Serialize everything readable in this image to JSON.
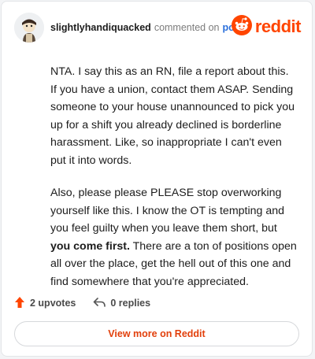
{
  "header": {
    "username": "slightlyhandiquacked",
    "commented_text": "commented on",
    "post_link": "post",
    "brand": "reddit"
  },
  "comment": {
    "p1": "NTA. I say this as an RN, file a report about this. If you have a union, contact them ASAP. Sending someone to your house unannounced to pick you up for a shift you already declined is borderline harassment. Like, so inappropriate I can't even put it into words.",
    "p2_start": "Also, please please PLEASE stop overworking yourself like this. I know the OT is tempting and you feel guilty when you leave them short, but ",
    "p2_bold": "you come first.",
    "p2_end": " There are a ton of positions open all over the place, get the hell out of this one and find somewhere that you're appreciated."
  },
  "actions": {
    "upvotes": "2 upvotes",
    "replies": "0 replies"
  },
  "view_button": "View more on Reddit",
  "colors": {
    "brand": "#ff4500",
    "link": "#2a6fdb",
    "button_text": "#e2400c"
  },
  "icons": {
    "upvote": "arrow-up-icon",
    "reply": "reply-arrow-icon",
    "logo": "reddit-snoo-icon"
  }
}
